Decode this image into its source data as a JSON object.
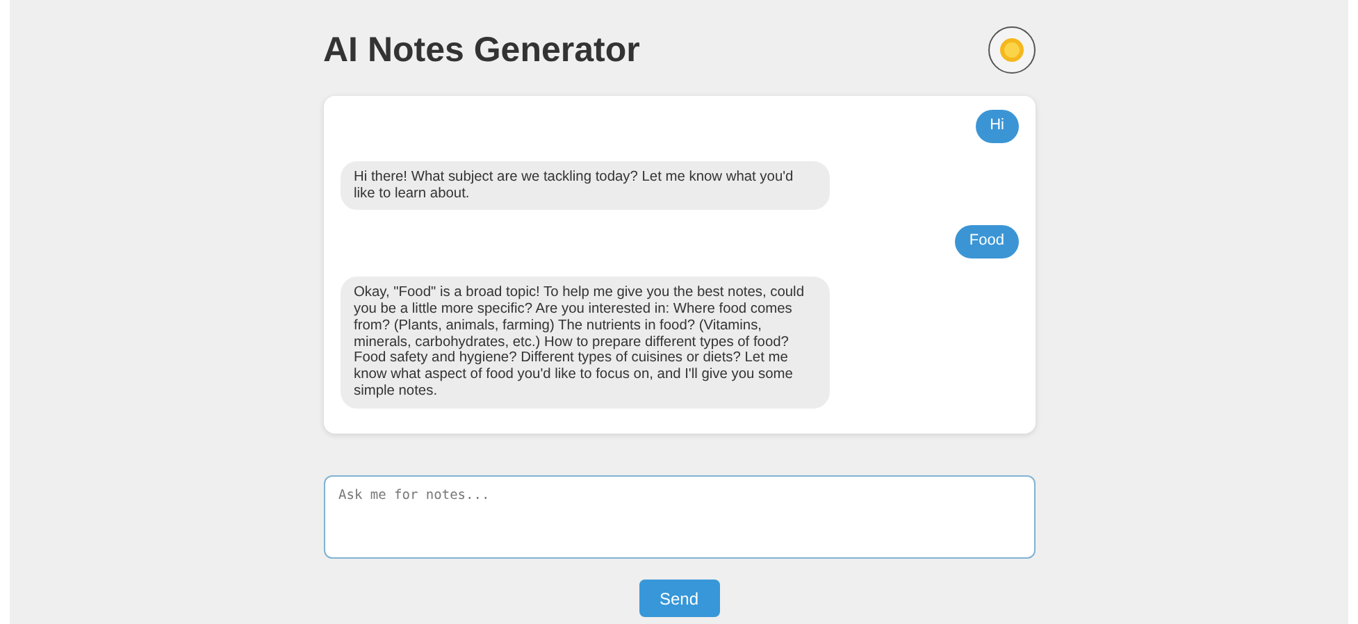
{
  "header": {
    "title": "AI Notes Generator"
  },
  "messages": [
    {
      "kind": "user",
      "text": "Hi"
    },
    {
      "kind": "bot",
      "text": "Hi there! What subject are we tackling today? Let me know what you'd like to learn about."
    },
    {
      "kind": "user",
      "text": "Food"
    },
    {
      "kind": "bot",
      "text": "Okay, \"Food\" is a broad topic! To help me give you the best notes, could you be a little more specific? Are you interested in: Where food comes from? (Plants, animals, farming) The nutrients in food? (Vitamins, minerals, carbohydrates, etc.) How to prepare different types of food? Food safety and hygiene? Different types of cuisines or diets? Let me know what aspect of food you'd like to focus on, and I'll give you some simple notes."
    }
  ],
  "composer": {
    "placeholder": "Ask me for notes...",
    "send_label": "Send"
  }
}
